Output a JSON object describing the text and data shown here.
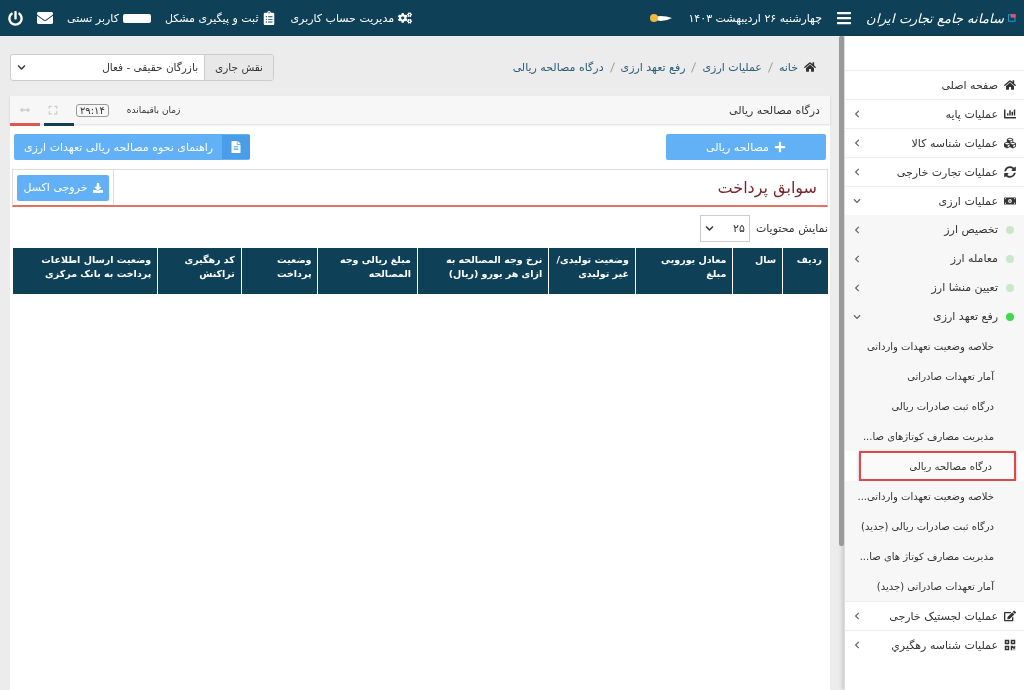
{
  "header": {
    "logo_text": "سامانه جامع تجارت ایران",
    "date": "چهارشنبه ۲۶ اردیبهشت ۱۴۰۳",
    "links": [
      {
        "label": "مدیریت حساب کاربری"
      },
      {
        "label": "ثبت و پیگیری مشکل"
      }
    ],
    "user": "کاربر تستی"
  },
  "breadcrumb": [
    "خانه",
    "عملیات ارزی",
    "رفع تعهد ارزی",
    "درگاه مصالحه ریالی"
  ],
  "role": {
    "label": "نقش جاری",
    "value": "بازرگان حقیقی - فعال"
  },
  "panel": {
    "title": "درگاه مصالحه ریالی",
    "timer_label": "زمان باقیمانده",
    "timer": "۲۹:۱۴"
  },
  "actions": [
    {
      "label": "مصالحه ریالی"
    },
    {
      "label": "راهنمای نحوه مصالحه ریالی تعهدات ارزی"
    }
  ],
  "section": {
    "title": "سوابق پرداخت",
    "export": "خروجی اکسل"
  },
  "page_size": {
    "label": "نمایش محتویات",
    "value": "۲۵"
  },
  "table": {
    "columns": [
      "ردیف",
      "سال",
      "معادل یورویی مبلغ",
      "وضعیت تولیدی/ غیر تولیدی",
      "نرخ وجه المصالحه به ازای هر یورو (ریال)",
      "مبلغ ریالی وجه المصالحه",
      "وضعیت پرداخت",
      "کد رهگیری تراکنش",
      "وضعیت ارسال اطلاعات پرداخت به بانک مرکزی"
    ]
  },
  "sidebar": {
    "items": [
      {
        "label": "صفحه اصلی"
      },
      {
        "label": "عملیات پایه",
        "expanded": false
      },
      {
        "label": "عملیات شناسه کالا",
        "expanded": false
      },
      {
        "label": "عملیات تجارت خارجی",
        "expanded": false
      },
      {
        "label": "عملیات ارزی",
        "expanded": true,
        "children": [
          {
            "label": "تخصیص ارز",
            "active": false,
            "expanded": false
          },
          {
            "label": "معامله ارز",
            "active": false,
            "expanded": false
          },
          {
            "label": "تعیین منشا ارز",
            "active": false,
            "expanded": false
          },
          {
            "label": "رفع تعهد ارزی",
            "active": true,
            "expanded": true,
            "children": [
              {
                "label": "خلاصه وضعیت تعهدات وارداتی",
                "selected": false
              },
              {
                "label": "آمار تعهدات صادراتی",
                "selected": false
              },
              {
                "label": "درگاه ثبت صادرات ریالی",
                "selected": false
              },
              {
                "label": "مدیریت مصارف کوتاژهای صا...",
                "selected": false
              },
              {
                "label": "درگاه مصالحه ریالی",
                "selected": true
              },
              {
                "label": "خلاصه وضعیت تعهدات وارداتی...",
                "selected": false
              },
              {
                "label": "درگاه ثبت صادرات ریالی (جدید)",
                "selected": false
              },
              {
                "label": "مدیریت مصارف کوتاژ های صا...",
                "selected": false
              },
              {
                "label": "آمار تعهدات صادراتی (جدید)",
                "selected": false
              }
            ]
          }
        ]
      },
      {
        "label": "عملیات لجستیک خارجی",
        "expanded": false
      },
      {
        "label": "عملیات شناسه رهگیري",
        "expanded": false
      }
    ]
  }
}
